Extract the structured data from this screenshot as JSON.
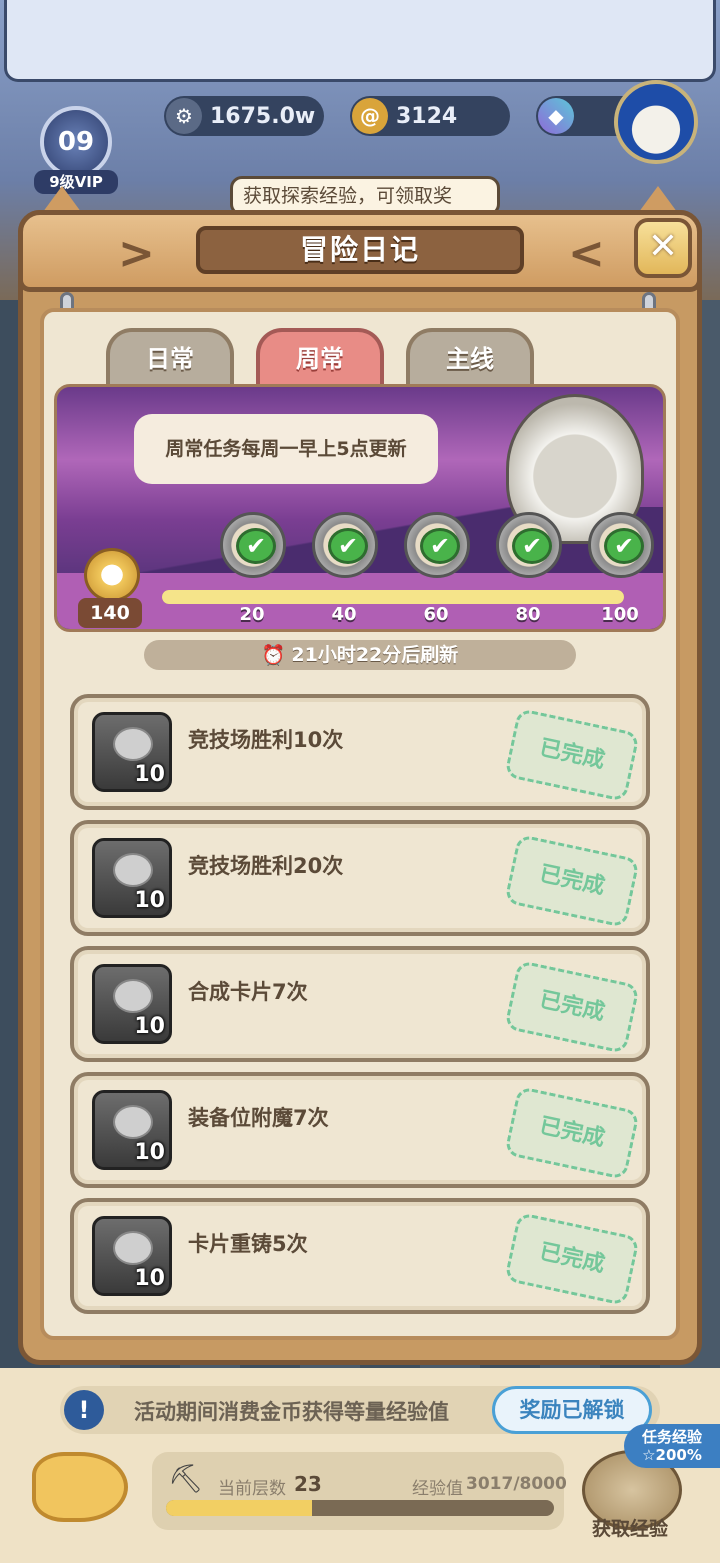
{
  "header": {
    "vip_level": "09",
    "vip_label": "9级VIP",
    "currency_1": "1675.0w",
    "currency_2": "3124",
    "currency_3": "",
    "tip": "获取探索经验，可领取奖"
  },
  "panel": {
    "title": "冒险日记",
    "close_symbol": "✕",
    "tabs": [
      {
        "label": "日常",
        "active": false
      },
      {
        "label": "周常",
        "active": true
      },
      {
        "label": "主线",
        "active": false
      }
    ]
  },
  "banner": {
    "speech": "周常任务每周一早上5点更新",
    "total_points": "140",
    "progress_fraction": 1.0,
    "milestones": [
      "20",
      "40",
      "60",
      "80",
      "100"
    ]
  },
  "refresh": {
    "icon": "alarm-clock-icon",
    "text": "21小时22分后刷新"
  },
  "tasks": [
    {
      "label": "竞技场胜利10次",
      "reward": "10",
      "status": "已完成"
    },
    {
      "label": "竞技场胜利20次",
      "reward": "10",
      "status": "已完成"
    },
    {
      "label": "合成卡片7次",
      "reward": "10",
      "status": "已完成"
    },
    {
      "label": "装备位附魔7次",
      "reward": "10",
      "status": "已完成"
    },
    {
      "label": "卡片重铸5次",
      "reward": "10",
      "status": "已完成"
    }
  ],
  "bottom": {
    "notice": "活动期间消费金币获得等量经验值",
    "unlock_button": "奖励已解锁",
    "level_label": "当前层数",
    "level_value": "23",
    "exp_label": "经验值",
    "exp_value": "3017/8000",
    "exp_fraction": 0.377,
    "get_exp_label": "获取经验",
    "bonus_line1": "任务经验",
    "bonus_line2": "☆200%"
  }
}
